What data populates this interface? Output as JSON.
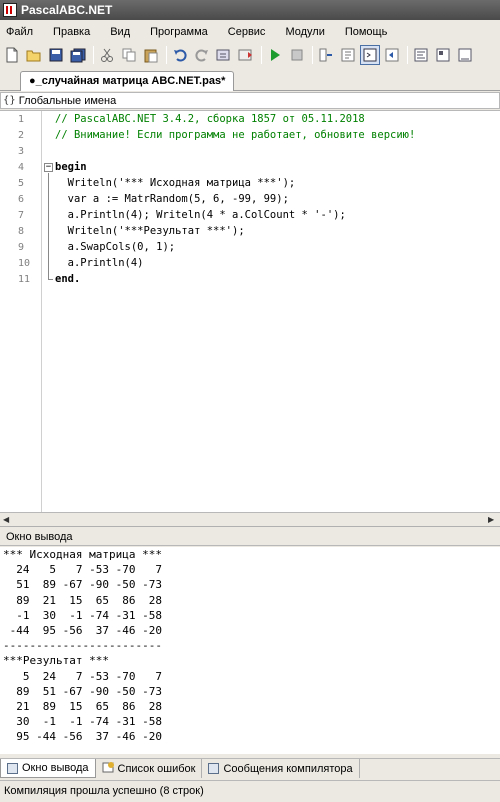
{
  "window": {
    "title": "PascalABC.NET"
  },
  "menu": [
    "Файл",
    "Правка",
    "Вид",
    "Программа",
    "Сервис",
    "Модули",
    "Помощь"
  ],
  "toolbar_icons": [
    "new-file-icon",
    "open-icon",
    "save-icon",
    "save-all-icon",
    "cut-icon",
    "copy-icon",
    "paste-icon",
    "undo-icon",
    "redo-icon",
    "run-icon",
    "stop-icon",
    "compile-icon",
    "debug-icon",
    "output-window-icon",
    "step-icon",
    "step-into-icon",
    "step-over-icon"
  ],
  "doc_tab": {
    "label": "●_случайная матрица ABC.NET.pas*"
  },
  "scope": {
    "label": "Глобальные имена"
  },
  "editor": {
    "line_numbers": [
      "1",
      "2",
      "3",
      "4",
      "5",
      "6",
      "7",
      "8",
      "9",
      "10",
      "11"
    ],
    "lines": [
      "// PascalABC.NET 3.4.2, сборка 1857 от 05.11.2018",
      "// Внимание! Если программа не работает, обновите версию!",
      "",
      "begin",
      "  Writeln('*** Исходная матрица ***');",
      "  var a := MatrRandom(5, 6, -99, 99);",
      "  a.Println(4); Writeln(4 * a.ColCount * '-');",
      "  Writeln('***Результат ***');",
      "  a.SwapCols(0, 1);",
      "  a.Println(4)",
      "end."
    ]
  },
  "output_panel": {
    "title": "Окно вывода",
    "lines": [
      "*** Исходная матрица ***",
      "  24   5   7 -53 -70   7",
      "  51  89 -67 -90 -50 -73",
      "  89  21  15  65  86  28",
      "  -1  30  -1 -74 -31 -58",
      " -44  95 -56  37 -46 -20",
      "------------------------",
      "***Результат ***",
      "   5  24   7 -53 -70   7",
      "  89  51 -67 -90 -50 -73",
      "  21  89  15  65  86  28",
      "  30  -1  -1 -74 -31 -58",
      "  95 -44 -56  37 -46 -20"
    ]
  },
  "bottom_tabs": [
    "Окно вывода",
    "Список ошибок",
    "Сообщения компилятора"
  ],
  "status": {
    "text": "Компиляция прошла успешно (8 строк)"
  },
  "colors": {
    "comment": "#008000",
    "string": "#0000c8",
    "titlebar": "#555555"
  }
}
